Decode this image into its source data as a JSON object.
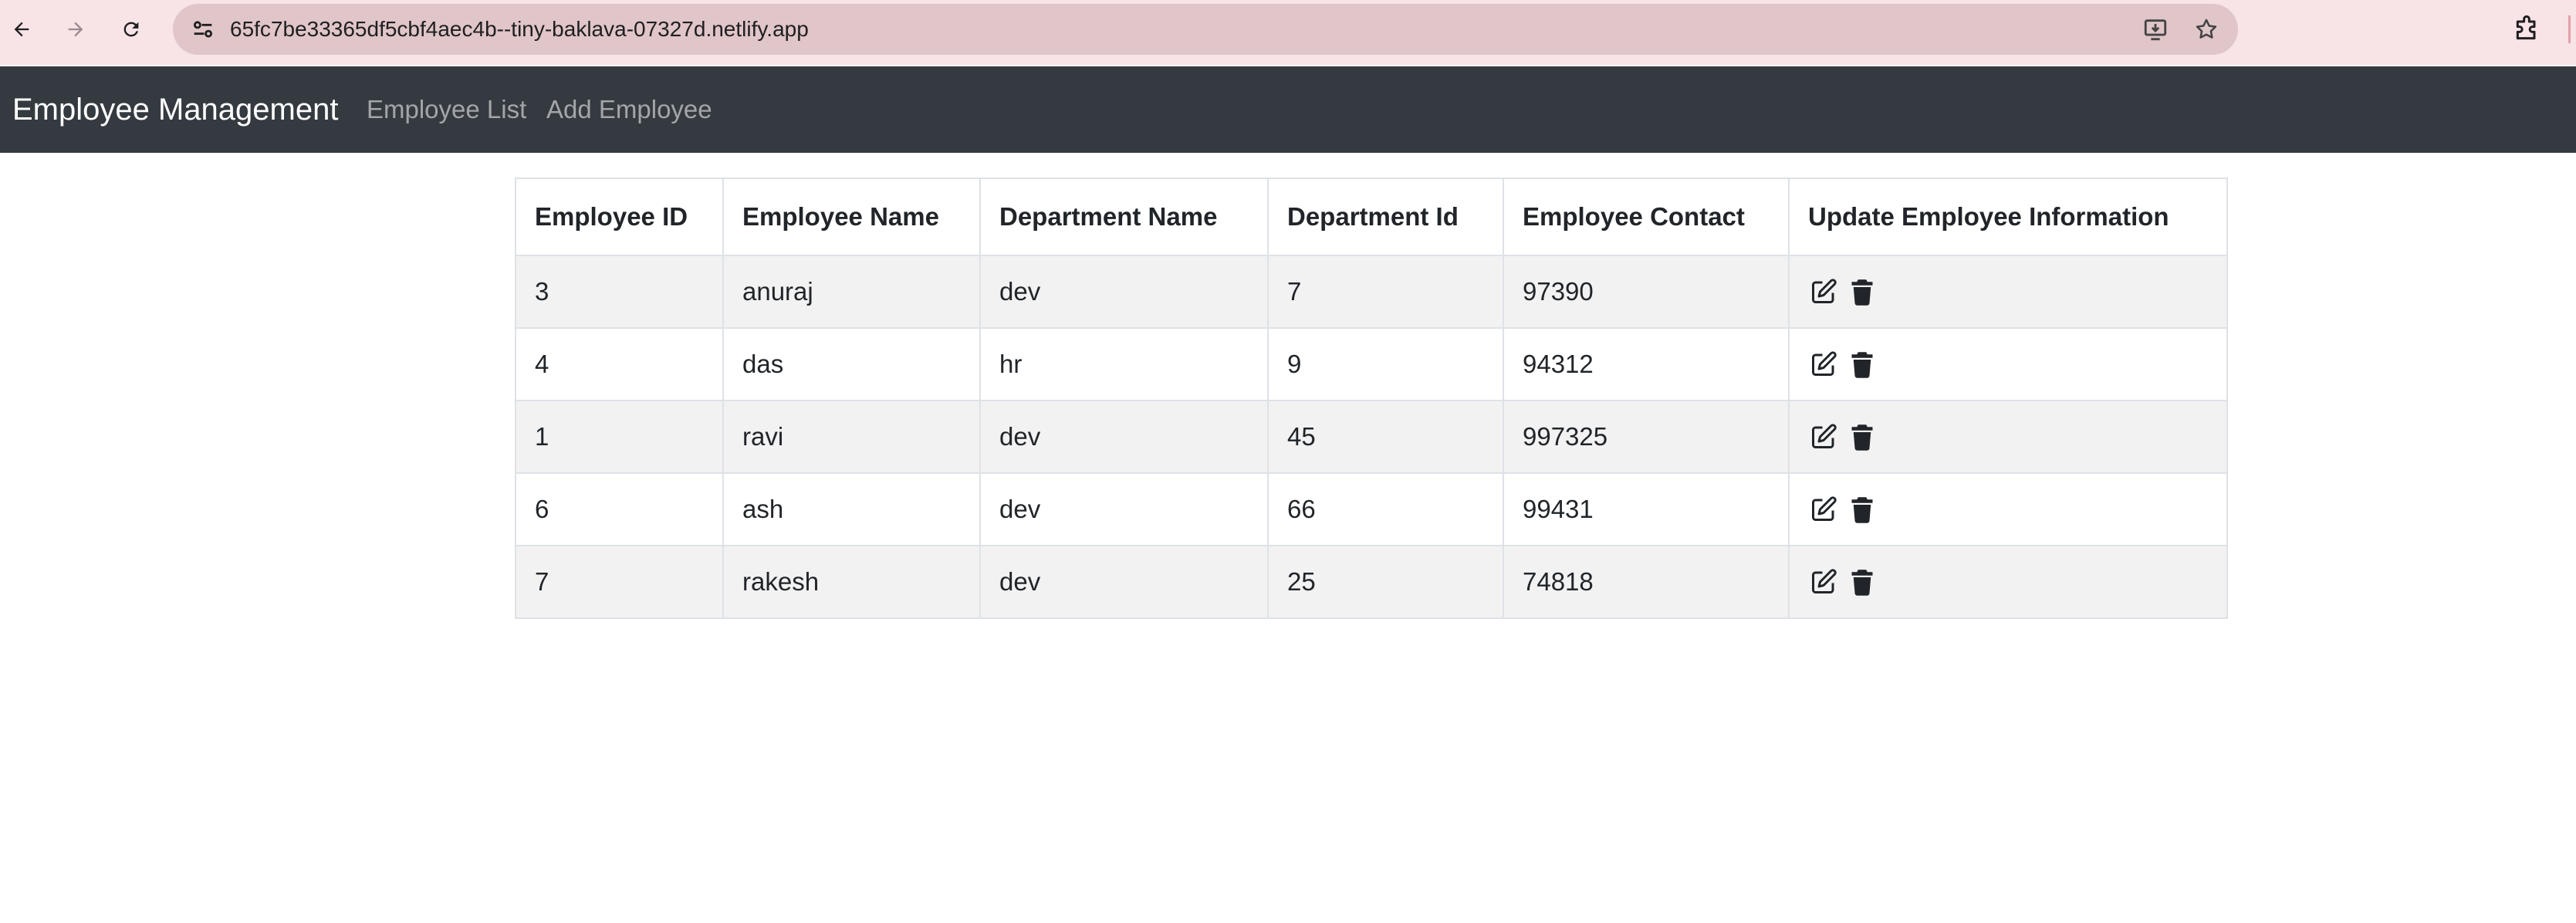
{
  "browser": {
    "url": "65fc7be33365df5cbf4aec4b--tiny-baklava-07327d.netlify.app"
  },
  "navbar": {
    "brand": "Employee Management",
    "links": [
      {
        "label": "Employee List"
      },
      {
        "label": "Add Employee"
      }
    ]
  },
  "table": {
    "headers": [
      "Employee ID",
      "Employee Name",
      "Department Name",
      "Department Id",
      "Employee Contact",
      "Update Employee Information"
    ],
    "rows": [
      [
        "3",
        "anuraj",
        "dev",
        "7",
        "97390"
      ],
      [
        "4",
        "das",
        "hr",
        "9",
        "94312"
      ],
      [
        "1",
        "ravi",
        "dev",
        "45",
        "997325"
      ],
      [
        "6",
        "ash",
        "dev",
        "66",
        "99431"
      ],
      [
        "7",
        "rakesh",
        "dev",
        "25",
        "74818"
      ]
    ],
    "row_actions": [
      "edit-icon",
      "trash-icon"
    ]
  }
}
